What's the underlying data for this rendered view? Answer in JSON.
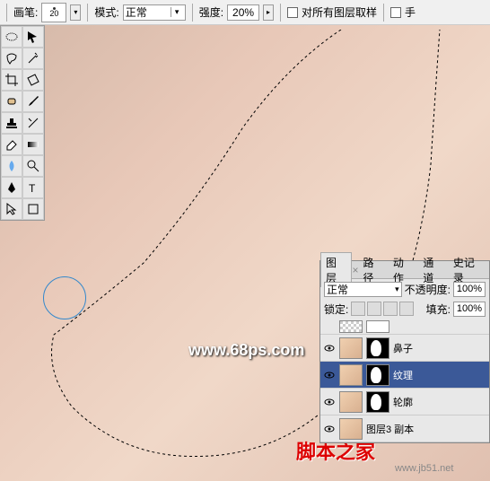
{
  "toolbar": {
    "brush_label": "画笔:",
    "brush_size": "20",
    "mode_label": "模式:",
    "mode_value": "正常",
    "strength_label": "强度:",
    "strength_value": "20%",
    "sample_all_label": "对所有图层取样",
    "hand_label": "手"
  },
  "layers_panel": {
    "tabs": [
      "图层",
      "路径",
      "动作",
      "通道",
      "史记录"
    ],
    "blend_mode": "正常",
    "opacity_label": "不透明度:",
    "opacity_value": "100%",
    "lock_label": "锁定:",
    "fill_label": "填充:",
    "fill_value": "100%",
    "layers": [
      {
        "name": "鼻子",
        "selected": false
      },
      {
        "name": "纹理",
        "selected": true
      },
      {
        "name": "轮廓",
        "selected": false
      },
      {
        "name": "图层3 副本",
        "selected": false
      }
    ]
  },
  "watermarks": {
    "w1": "www.68ps.com",
    "w2": "脚本之家",
    "w3": "www.jb51.net"
  }
}
